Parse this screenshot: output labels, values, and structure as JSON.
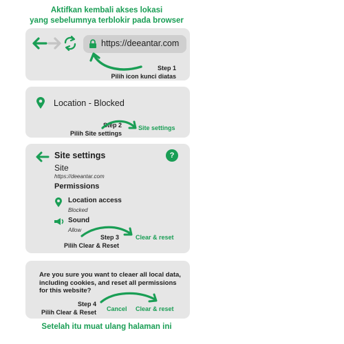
{
  "heading": {
    "line1": "Aktifkan kembali akses lokasi",
    "line2": "yang sebelumnya terblokir pada browser"
  },
  "step1": {
    "url": "https://deeantar.com",
    "step_label": "Step 1",
    "instruction": "Pilih icon kunci diatas"
  },
  "step2": {
    "site_label": "Location - Blocked",
    "step_label": "Step 2",
    "instruction": "Pilih Site settings",
    "link": "Site settings"
  },
  "step3": {
    "title": "Site settings",
    "site_heading": "Site",
    "site_url": "https://deeantar.com",
    "permissions_heading": "Permissions",
    "location_label": "Location access",
    "location_value": "Blocked",
    "sound_label": "Sound",
    "sound_value": "Allow",
    "step_label": "Step 3",
    "instruction": "Pilih Clear & Reset",
    "link": "Clear & reset",
    "help": "?"
  },
  "step4": {
    "line1": "Are you sure you want to cleaer all local data,",
    "line2": "including cookies, and reset all permissions",
    "line3": "for this website?",
    "step_label": "Step 4",
    "instruction": "Pilih Clear & Reset",
    "cancel": "Cancel",
    "confirm": "Clear & reset"
  },
  "footer": "Setelah itu muat ulang halaman ini",
  "colors": {
    "accent": "#1a9e55",
    "panel": "#e6e6e6",
    "url_box": "#cfcfcf"
  },
  "icons": [
    "back-arrow-icon",
    "forward-arrow-icon",
    "reload-icon",
    "lock-icon",
    "location-pin-icon",
    "speaker-icon",
    "help-icon"
  ]
}
